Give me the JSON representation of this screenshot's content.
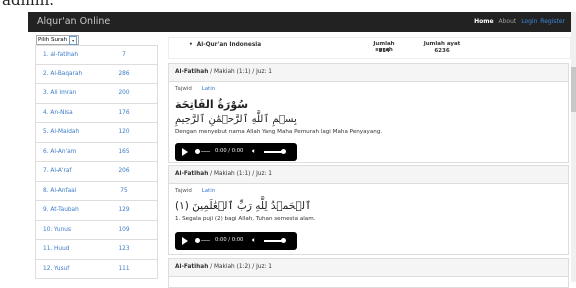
{
  "page_top_text": "admin.",
  "navbar": {
    "brand": "Alqur'an Online",
    "home": "Home",
    "about": "About",
    "login": "Login",
    "register": "Register"
  },
  "sidebar": {
    "select_value": "Pilih Surah",
    "surahs": [
      {
        "name": "1. al-fatihah",
        "ayat": "7"
      },
      {
        "name": "2. Al-Baqarah",
        "ayat": "286"
      },
      {
        "name": "3. Ali Imran",
        "ayat": "200"
      },
      {
        "name": "4. An-Nisa",
        "ayat": "176"
      },
      {
        "name": "5. Al-Maidah",
        "ayat": "120"
      },
      {
        "name": "6. Al-An'am",
        "ayat": "165"
      },
      {
        "name": "7. Al-A'raf",
        "ayat": "206"
      },
      {
        "name": "8. Al-Anfaal",
        "ayat": "75"
      },
      {
        "name": "9. At-Taubah",
        "ayat": "129"
      },
      {
        "name": "10. Yunus",
        "ayat": "109"
      },
      {
        "name": "11. Huud",
        "ayat": "123"
      },
      {
        "name": "12. Yusuf",
        "ayat": "111"
      }
    ]
  },
  "info": {
    "title": "Al-Qur'an Indonesia",
    "jumlah_surah_label": "Jumlah surah",
    "jumlah_surah_value": "114",
    "jumlah_ayat_label": "Jumlah ayat",
    "jumlah_ayat_value": "6236"
  },
  "tabs": {
    "tajwid": "Tajwid",
    "latin": "Latin"
  },
  "player": {
    "time": "0:00 / 0:00"
  },
  "panels": [
    {
      "surah": "Al-Fatihah",
      "meta": " / Makiah (1:1) / Juz: 1",
      "arabic_title": "سُوْرَةُ الفَاتِحَة",
      "arabic": "بِسۡمِ ٱللَّهِ ٱلرَّحۡمَٰنِ ٱلرَّحِيمِ",
      "translation": "Dengan menyebut nama Allah Yang Maha Pemurah lagi Maha Penyayang."
    },
    {
      "surah": "Al-Fatihah",
      "meta": " / Makiah (1:1) / Juz: 1",
      "arabic": "ٱلۡحَمۡدُ لِلَّهِ رَبِّ ٱلۡعَٰلَمِينَ (١)",
      "translation": "1. Segala puji (2) bagi Allah, Tuhan semesta alam."
    },
    {
      "surah": "Al-Fatihah",
      "meta": " / Makiah (1:2) / Juz: 1"
    }
  ]
}
